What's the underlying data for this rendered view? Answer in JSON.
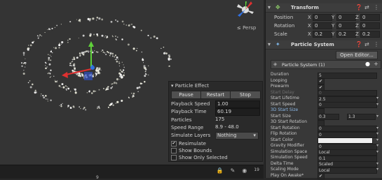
{
  "scene": {
    "persp_label": "≤ Persp"
  },
  "particle_effect": {
    "title": "Particle Effect",
    "buttons": {
      "pause": "Pause",
      "restart": "Restart",
      "stop": "Stop"
    },
    "playback_speed_label": "Playback Speed",
    "playback_speed": "1.00",
    "playback_time_label": "Playback Time",
    "playback_time": "60.19",
    "particles_label": "Particles",
    "particles": "175",
    "speed_range_label": "Speed Range",
    "speed_range": "8.9 - 48.0",
    "simulate_layers_label": "Simulate Layers",
    "simulate_layers": "Nothing",
    "resimulate_label": "Resimulate",
    "show_bounds_label": "Show Bounds",
    "show_only_selected_label": "Show Only Selected"
  },
  "inspector": {
    "transform": {
      "title": "Transform",
      "position_label": "Position",
      "rotation_label": "Rotation",
      "scale_label": "Scale",
      "position": [
        "0",
        "0",
        "0"
      ],
      "rotation": [
        "0",
        "0",
        "0"
      ],
      "scale": [
        "0.2",
        "0.2",
        "0.2"
      ],
      "axes": [
        "X",
        "Y",
        "Z"
      ]
    },
    "particle_system": {
      "title": "Particle System",
      "open_editor": "Open Editor...",
      "sub_title": "Particle System (1)",
      "props": [
        {
          "label": "Duration",
          "value": "5"
        },
        {
          "label": "Looping",
          "value": "✔"
        },
        {
          "label": "Prewarm",
          "value": "✔"
        },
        {
          "label": "Start Delay",
          "value": "0"
        },
        {
          "label": "Start Lifetime",
          "value": "2.5"
        },
        {
          "label": "Start Speed",
          "value": "0"
        },
        {
          "label": "3D Start Size",
          "value": ""
        },
        {
          "label": "Start Size",
          "value": "0.3"
        },
        {
          "label": "3D Start Rotation",
          "value": ""
        },
        {
          "label": "Start Rotation",
          "value": "0"
        },
        {
          "label": "Flip Rotation",
          "value": "0"
        },
        {
          "label": "Start Color",
          "value": ""
        },
        {
          "label": "Gravity Modifier",
          "value": "0"
        },
        {
          "label": "Simulation Space",
          "value": "Local"
        },
        {
          "label": "Simulation Speed",
          "value": "0.1"
        },
        {
          "label": "Delta Time",
          "value": "Scaled"
        },
        {
          "label": "Scaling Mode",
          "value": "Local"
        },
        {
          "label": "Play On Awake*",
          "value": "✔"
        }
      ],
      "start_size_max": "1.3"
    }
  },
  "bottom": {
    "field_text": "9",
    "visible_count": "19"
  },
  "colors": {
    "accent": "#4a7fc1",
    "x_axis": "#e03030",
    "y_axis": "#5fd03a",
    "z_axis": "#3070e0"
  }
}
